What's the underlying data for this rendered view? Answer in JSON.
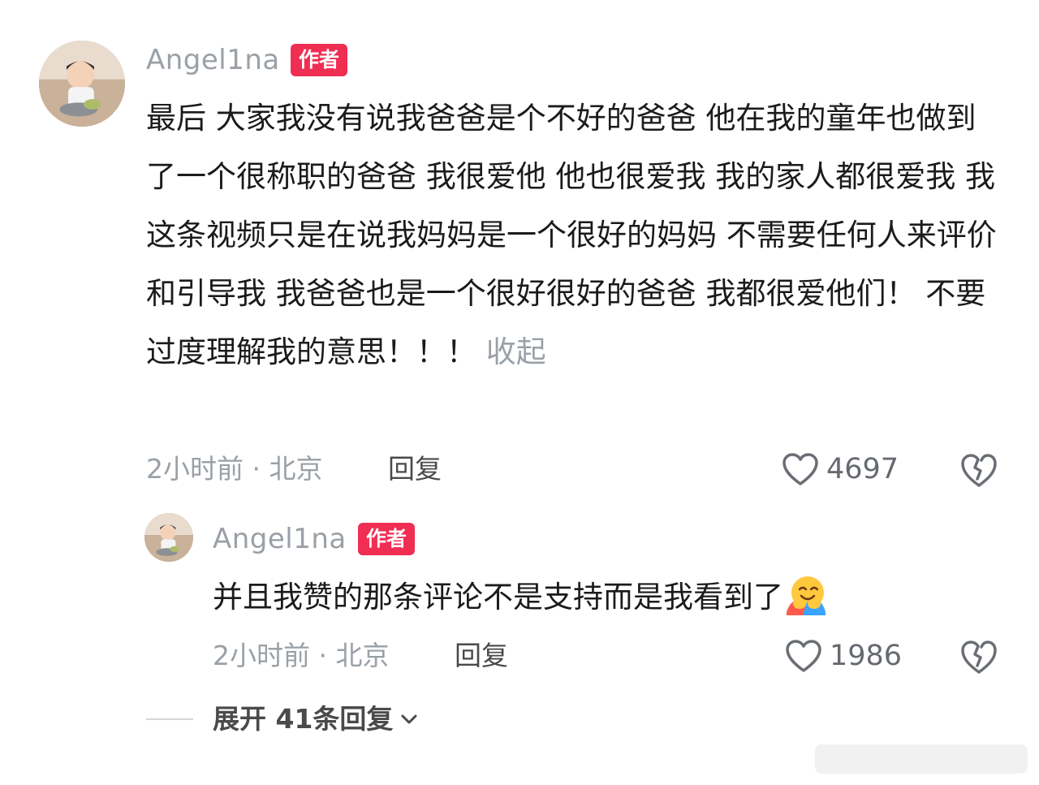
{
  "comment": {
    "username": "Angel1na",
    "author_badge": "作者",
    "text": "最后 大家我没有说我爸爸是个不好的爸爸 他在我的童年也做到了一个很称职的爸爸 我很爱他 他也很爱我 我的家人都很爱我 我这条视频只是在说我妈妈是一个很好的妈妈 不需要任何人来评价和引导我 我爸爸也是一个很好很好的爸爸 我都很爱他们！ 不要过度理解我的意思！！！",
    "collapse_label": "收起",
    "meta": "2小时前 · 北京",
    "reply_label": "回复",
    "like_count": "4697"
  },
  "reply": {
    "username": "Angel1na",
    "author_badge": "作者",
    "text": "并且我赞的那条评论不是支持而是我看到了",
    "meta": "2小时前 · 北京",
    "reply_label": "回复",
    "like_count": "1986"
  },
  "expand_label": "展开 41条回复",
  "colors": {
    "badge": "#f02d52",
    "muted": "#9aa0a6"
  }
}
